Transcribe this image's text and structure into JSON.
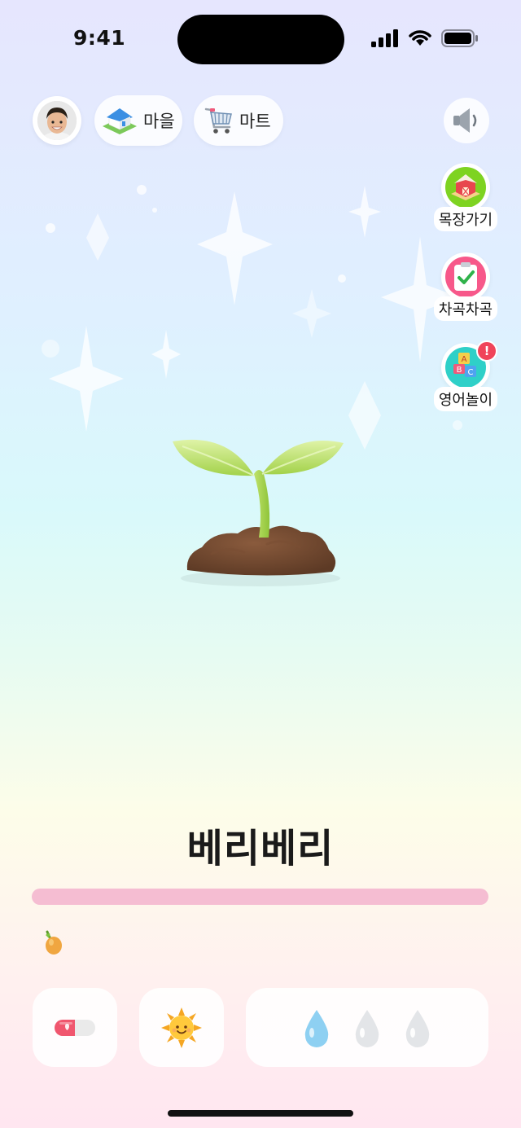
{
  "status_bar": {
    "time": "9:41"
  },
  "top_bar": {
    "village_label": "마을",
    "mart_label": "마트"
  },
  "side_menu": {
    "farm_label": "목장가기",
    "check_label": "차곡차곡",
    "english_label": "영어놀이",
    "english_badge": "!"
  },
  "plant": {
    "name": "베리베리",
    "growth_progress": 1.0
  },
  "actions": {
    "water_total": 3,
    "water_filled": 1
  },
  "colors": {
    "progress": "#f5bdd2",
    "badge": "#f0445a",
    "farm_icon_bg": "#7ed321",
    "check_icon_bg": "#f7588a",
    "english_icon_bg": "#2fd0c8"
  }
}
